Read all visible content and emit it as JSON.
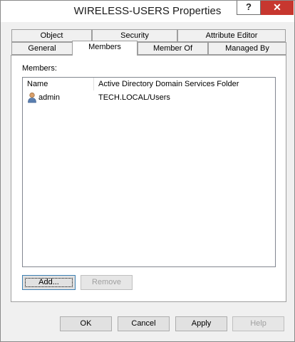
{
  "window": {
    "title": "WIRELESS-USERS Properties",
    "help_glyph": "?",
    "close_glyph": "✕"
  },
  "tabs_row1": [
    {
      "label": "Object"
    },
    {
      "label": "Security"
    },
    {
      "label": "Attribute Editor"
    }
  ],
  "tabs_row2": [
    {
      "label": "General"
    },
    {
      "label": "Members"
    },
    {
      "label": "Member Of"
    },
    {
      "label": "Managed By"
    }
  ],
  "active_tab": "Members",
  "members": {
    "label": "Members:",
    "columns": [
      "Name",
      "Active Directory Domain Services Folder"
    ],
    "rows": [
      {
        "name": "admin",
        "folder": "TECH.LOCAL/Users",
        "icon": "user-icon"
      }
    ],
    "add_label": "Add...",
    "remove_label": "Remove"
  },
  "footer": {
    "ok_label": "OK",
    "cancel_label": "Cancel",
    "apply_label": "Apply",
    "help_label": "Help"
  }
}
